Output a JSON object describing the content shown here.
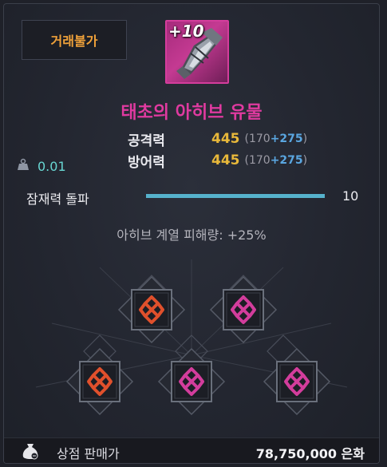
{
  "tooltip": {
    "trade_status": "거래불가",
    "enhance_level": "+10",
    "item_name": "태초의 아히브 유물",
    "stats": [
      {
        "label": "공격력",
        "value": "445",
        "base": "170",
        "bonus": "+275"
      },
      {
        "label": "방어력",
        "value": "445",
        "base": "170",
        "bonus": "+275"
      }
    ],
    "weight": "0.01",
    "breakthrough": {
      "label": "잠재력 돌파",
      "value": "10",
      "progress_fraction": 1.0
    },
    "effect": "아히브 계열 피해량: +25%",
    "engravings": [
      {
        "name": "slot-1",
        "color": "#e0502c"
      },
      {
        "name": "slot-2",
        "color": "#d33d9c"
      },
      {
        "name": "slot-3",
        "color": "#e0502c"
      },
      {
        "name": "slot-4",
        "color": "#d33d9c"
      },
      {
        "name": "slot-5",
        "color": "#d33d9c"
      }
    ],
    "shop": {
      "label": "상점 판매가",
      "value": "78,750,000 은화"
    },
    "colors": {
      "trade_status": "#f0a23a",
      "item_name": "#e03aa0",
      "stat_value": "#e8b83a",
      "stat_bonus": "#5aa6e0",
      "weight": "#68d6d2",
      "bar_fill": "#56b2cc"
    },
    "icons": {
      "weight": "weight-icon",
      "shop": "coin-bag-icon",
      "item": "relic-item-icon"
    }
  }
}
